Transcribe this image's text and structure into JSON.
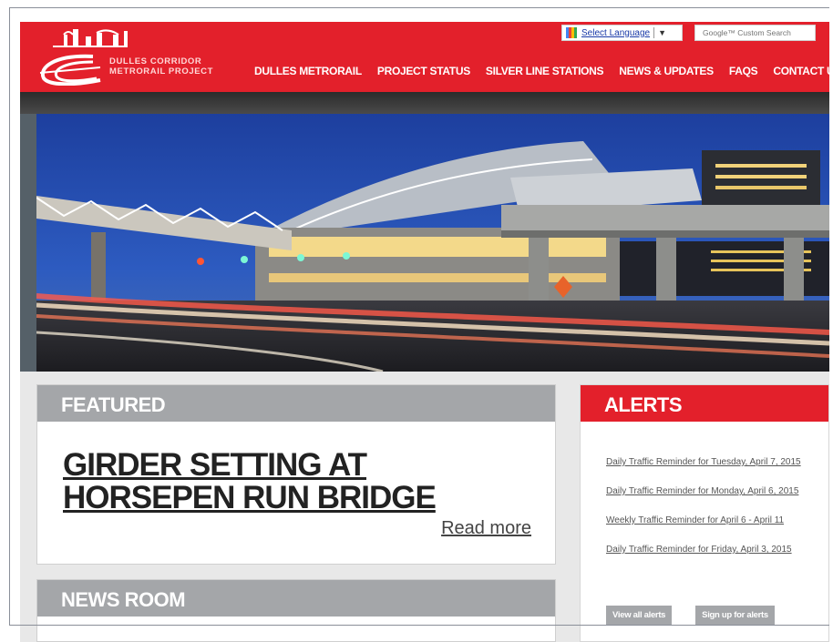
{
  "header": {
    "logo_text": [
      "DULLES CORRIDOR",
      "METRORAIL PROJECT"
    ],
    "language_label": "Select Language",
    "search_placeholder": "Google™ Custom Search",
    "nav": [
      "DULLES METRORAIL",
      "PROJECT STATUS",
      "SILVER LINE STATIONS",
      "NEWS & UPDATES",
      "FAQS",
      "CONTACT US"
    ]
  },
  "featured": {
    "heading": "FEATURED",
    "title": "GIRDER SETTING AT HORSEPEN RUN BRIDGE",
    "read_more": "Read more"
  },
  "newsroom": {
    "heading": "NEWS ROOM"
  },
  "alerts": {
    "heading": "ALERTS",
    "items": [
      "Daily Traffic Reminder for Tuesday, April 7, 2015",
      "Daily Traffic Reminder for Monday, April 6, 2015",
      "Weekly Traffic Reminder for April 6 - April 11",
      "Daily Traffic Reminder for Friday, April 3, 2015"
    ],
    "view_all": "View all alerts",
    "sign_up": "Sign up for alerts"
  },
  "colors": {
    "brand_red": "#e3202b",
    "panel_gray": "#a4a6a9"
  }
}
